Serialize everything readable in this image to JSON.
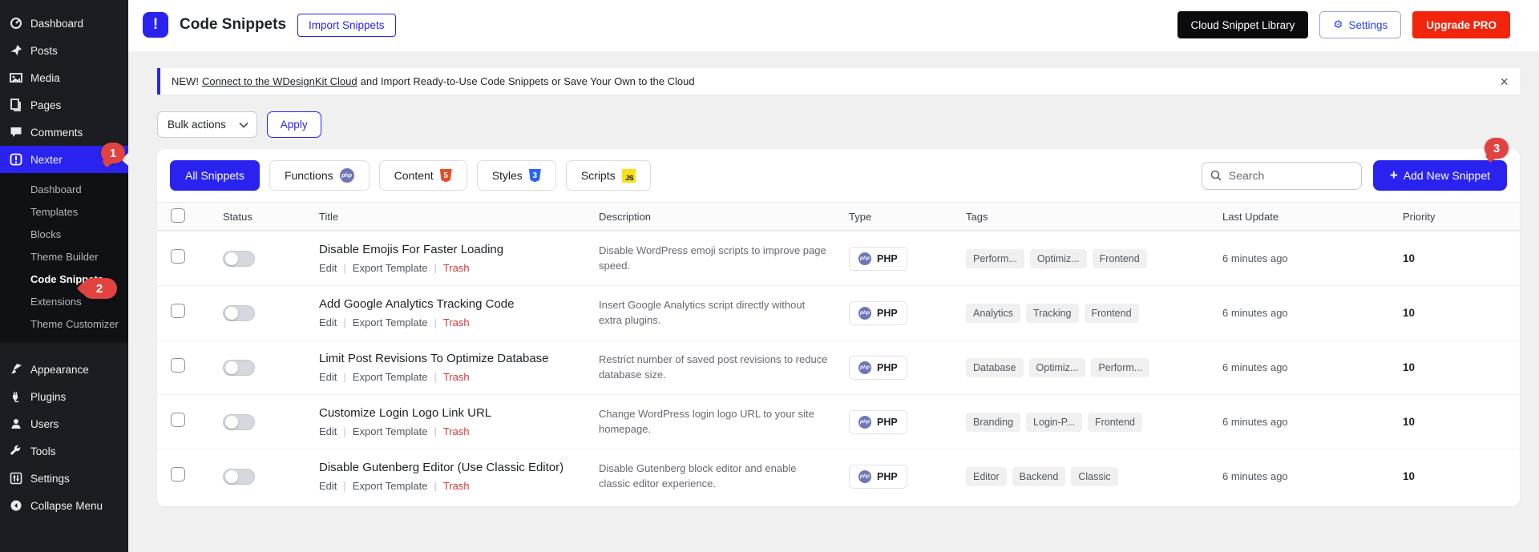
{
  "colors": {
    "accent": "#2a23ef",
    "danger": "#f2250c",
    "badge_red": "#e04340",
    "sidebar_bg": "#1b1d22"
  },
  "sidebar": {
    "top": [
      {
        "label": "Dashboard"
      },
      {
        "label": "Posts"
      },
      {
        "label": "Media"
      },
      {
        "label": "Pages"
      },
      {
        "label": "Comments"
      }
    ],
    "nexter": {
      "label": "Nexter",
      "badge": "1"
    },
    "submenu": [
      {
        "label": "Dashboard"
      },
      {
        "label": "Templates"
      },
      {
        "label": "Blocks"
      },
      {
        "label": "Theme Builder"
      },
      {
        "label": "Code Snippets",
        "badge": "2"
      },
      {
        "label": "Extensions"
      },
      {
        "label": "Theme Customizer"
      }
    ],
    "bottom": [
      {
        "label": "Appearance"
      },
      {
        "label": "Plugins"
      },
      {
        "label": "Users"
      },
      {
        "label": "Tools"
      },
      {
        "label": "Settings"
      },
      {
        "label": "Collapse Menu"
      }
    ]
  },
  "header": {
    "icon": "!",
    "title": "Code Snippets",
    "import_button": "Import Snippets",
    "cloud_library_button": "Cloud Snippet Library",
    "settings_button": "Settings",
    "settings_icon": "⚙",
    "upgrade_button": "Upgrade PRO"
  },
  "notice": {
    "prefix": "NEW!",
    "link": "Connect to the WDesignKit Cloud",
    "suffix": "and Import Ready-to-Use Code Snippets or Save Your Own to the Cloud",
    "close": "×"
  },
  "bulk": {
    "select_label": "Bulk actions",
    "apply_label": "Apply"
  },
  "tabs": [
    {
      "label": "All Snippets"
    },
    {
      "label": "Functions",
      "icon_text": "php"
    },
    {
      "label": "Content",
      "icon_text": "5"
    },
    {
      "label": "Styles",
      "icon_text": "3"
    },
    {
      "label": "Scripts",
      "icon_text": "JS"
    }
  ],
  "toolbar": {
    "search_placeholder": "Search",
    "add_button": "Add New Snippet",
    "add_plus": "+",
    "add_badge": "3"
  },
  "table": {
    "headers": [
      "Status",
      "Title",
      "Description",
      "Type",
      "Tags",
      "Last Update",
      "Priority"
    ],
    "actions": {
      "edit": "Edit",
      "export": "Export Template",
      "trash": "Trash"
    },
    "type_icon_text": "php",
    "rows": [
      {
        "title": "Disable Emojis For Faster Loading",
        "description": "Disable WordPress emoji scripts to improve page speed.",
        "type": "PHP",
        "tags": [
          "Perform...",
          "Optimiz...",
          "Frontend"
        ],
        "last_update": "6 minutes ago",
        "priority": "10"
      },
      {
        "title": "Add Google Analytics Tracking Code",
        "description": "Insert Google Analytics script directly without extra plugins.",
        "type": "PHP",
        "tags": [
          "Analytics",
          "Tracking",
          "Frontend"
        ],
        "last_update": "6 minutes ago",
        "priority": "10"
      },
      {
        "title": "Limit Post Revisions To Optimize Database",
        "description": "Restrict number of saved post revisions to reduce database size.",
        "type": "PHP",
        "tags": [
          "Database",
          "Optimiz...",
          "Perform..."
        ],
        "last_update": "6 minutes ago",
        "priority": "10"
      },
      {
        "title": "Customize Login Logo Link URL",
        "description": "Change WordPress login logo URL to your site homepage.",
        "type": "PHP",
        "tags": [
          "Branding",
          "Login-P...",
          "Frontend"
        ],
        "last_update": "6 minutes ago",
        "priority": "10"
      },
      {
        "title": "Disable Gutenberg Editor (Use Classic Editor)",
        "description": "Disable Gutenberg block editor and enable classic editor experience.",
        "type": "PHP",
        "tags": [
          "Editor",
          "Backend",
          "Classic"
        ],
        "last_update": "6 minutes ago",
        "priority": "10"
      }
    ]
  }
}
